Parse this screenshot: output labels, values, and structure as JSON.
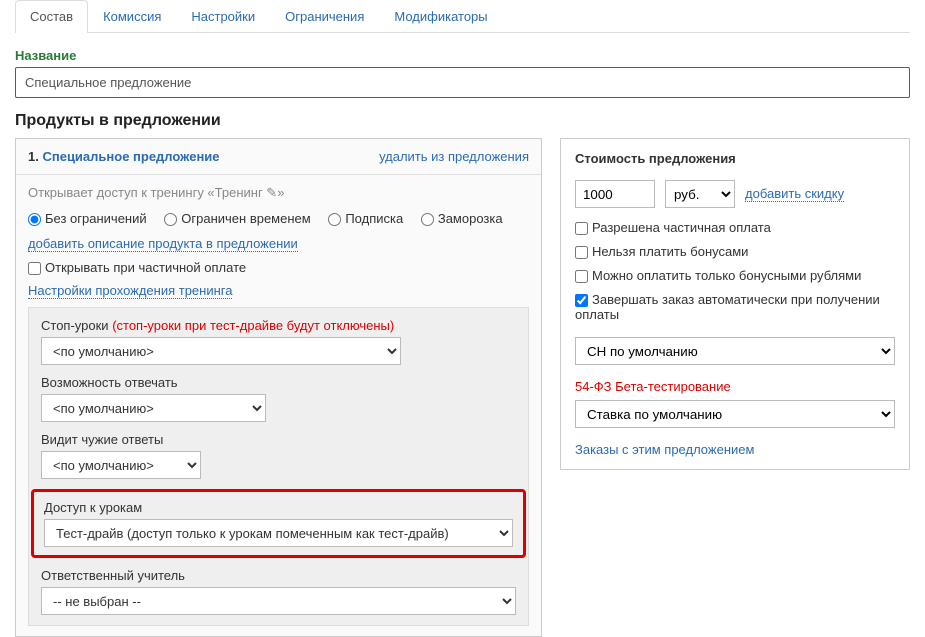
{
  "tabs": [
    "Состав",
    "Комиссия",
    "Настройки",
    "Ограничения",
    "Модификаторы"
  ],
  "nameLabel": "Название",
  "nameValue": "Специальное предложение",
  "productsTitle": "Продукты в предложении",
  "product": {
    "num": "1.",
    "title": "Специальное предложение",
    "removeLink": "удалить из предложения",
    "accessText": "Открывает доступ к тренингу «Тренинг ✎»",
    "radios": [
      "Без ограничений",
      "Ограничен временем",
      "Подписка",
      "Заморозка"
    ],
    "addDescLink": "добавить описание продукта в предложении",
    "partialPayLabel": "Открывать при частичной оплате",
    "trainingSettingsLink": "Настройки прохождения тренинга",
    "stopLessonsLabel": "Стоп-уроки",
    "stopLessonsNote": "(стоп-уроки при тест-драйве будут отключены)",
    "defaultOption": "<по умолчанию>",
    "canAnswerLabel": "Возможность отвечать",
    "seeOthersLabel": "Видит чужие ответы",
    "accessLessonsLabel": "Доступ к урокам",
    "accessLessonsValue": "Тест-драйв (доступ только к урокам помеченным как тест-драйв)",
    "teacherLabel": "Ответственный учитель",
    "teacherValue": "-- не выбран --"
  },
  "pricing": {
    "title": "Стоимость предложения",
    "price": "1000",
    "currency": "руб.",
    "addDiscount": "добавить скидку",
    "partialAllowed": "Разрешена частичная оплата",
    "noBonuses": "Нельзя платить бонусами",
    "onlyBonuses": "Можно оплатить только бонусными рублями",
    "autoComplete": "Завершать заказ автоматически при получении оплаты",
    "chDefault": "СН по умолчанию",
    "betaText": "54-ФЗ Бета-тестирование",
    "rateDefault": "Ставка по умолчанию",
    "ordersLink": "Заказы с этим предложением"
  }
}
